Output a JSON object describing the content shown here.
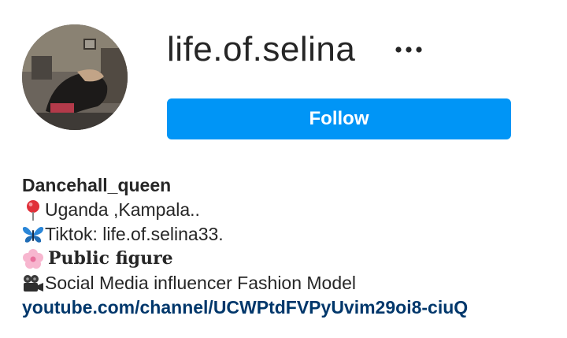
{
  "profile": {
    "username": "life.of.selina",
    "follow_label": "Follow",
    "avatar_icon": "profile-photo",
    "more_icon": "more-options-icon"
  },
  "bio": {
    "name": "Dancehall_queen",
    "location": "Uganda ,Kampala..",
    "tiktok": "Tiktok: life.of.selina33.",
    "category": "Public figure",
    "description": "Social Media influencer Fashion Model",
    "link": "youtube.com/channel/UCWPtdFVPyUvim29oi8-ciuQ"
  },
  "colors": {
    "follow_button": "#0095f6",
    "link": "#00376b",
    "text": "#262626"
  }
}
